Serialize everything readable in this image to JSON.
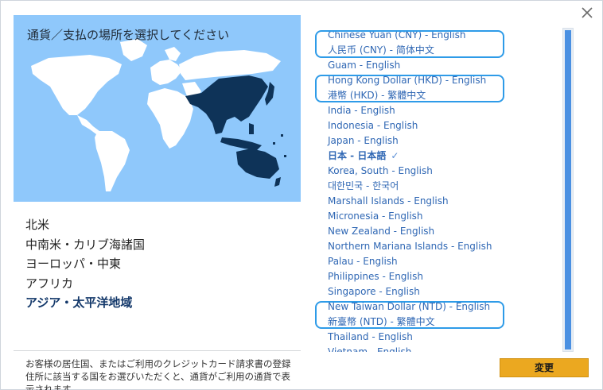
{
  "map": {
    "title": "通貨／支払の場所を選択してください",
    "colors": {
      "ocean": "#8fc8fb",
      "land": "#ffffff",
      "highlight": "#0e3358"
    }
  },
  "regions": [
    {
      "label": "北米",
      "active": false
    },
    {
      "label": "中南米・カリブ海諸国",
      "active": false
    },
    {
      "label": "ヨーロッパ・中東",
      "active": false
    },
    {
      "label": "アフリカ",
      "active": false
    },
    {
      "label": "アジア・太平洋地域",
      "active": true
    }
  ],
  "countries": [
    {
      "label": "Chinese Yuan (CNY) - English"
    },
    {
      "label": "人民币 (CNY) - 简体中文"
    },
    {
      "label": "Guam - English"
    },
    {
      "label": "Hong Kong Dollar (HKD) - English"
    },
    {
      "label": "港幣 (HKD) - 繁體中文"
    },
    {
      "label": "India - English"
    },
    {
      "label": "Indonesia - English"
    },
    {
      "label": "Japan - English"
    },
    {
      "label": "日本 - 日本語",
      "selected": true
    },
    {
      "label": "Korea, South - English"
    },
    {
      "label": "대한민국 - 한국어"
    },
    {
      "label": "Marshall Islands - English"
    },
    {
      "label": "Micronesia - English"
    },
    {
      "label": "New Zealand - English"
    },
    {
      "label": "Northern Mariana Islands - English"
    },
    {
      "label": "Palau - English"
    },
    {
      "label": "Philippines - English"
    },
    {
      "label": "Singapore - English"
    },
    {
      "label": "New Taiwan Dollar (NTD) - English"
    },
    {
      "label": "新臺幣 (NTD) - 繁體中文"
    },
    {
      "label": "Thailand - English"
    },
    {
      "label": "Vietnam - English"
    }
  ],
  "selected_check": "✓",
  "note": "お客様の居住国、またはご利用のクレジットカード請求書の登録住所に該当する国をお選びいただくと、通貨がご利用の通貨で表示されます。",
  "buttons": {
    "change": "変更"
  },
  "colors": {
    "accent": "#2f67b4",
    "button": "#eba820",
    "highlight_box": "#2e9be8",
    "scrollbar": "#4a90e2"
  }
}
